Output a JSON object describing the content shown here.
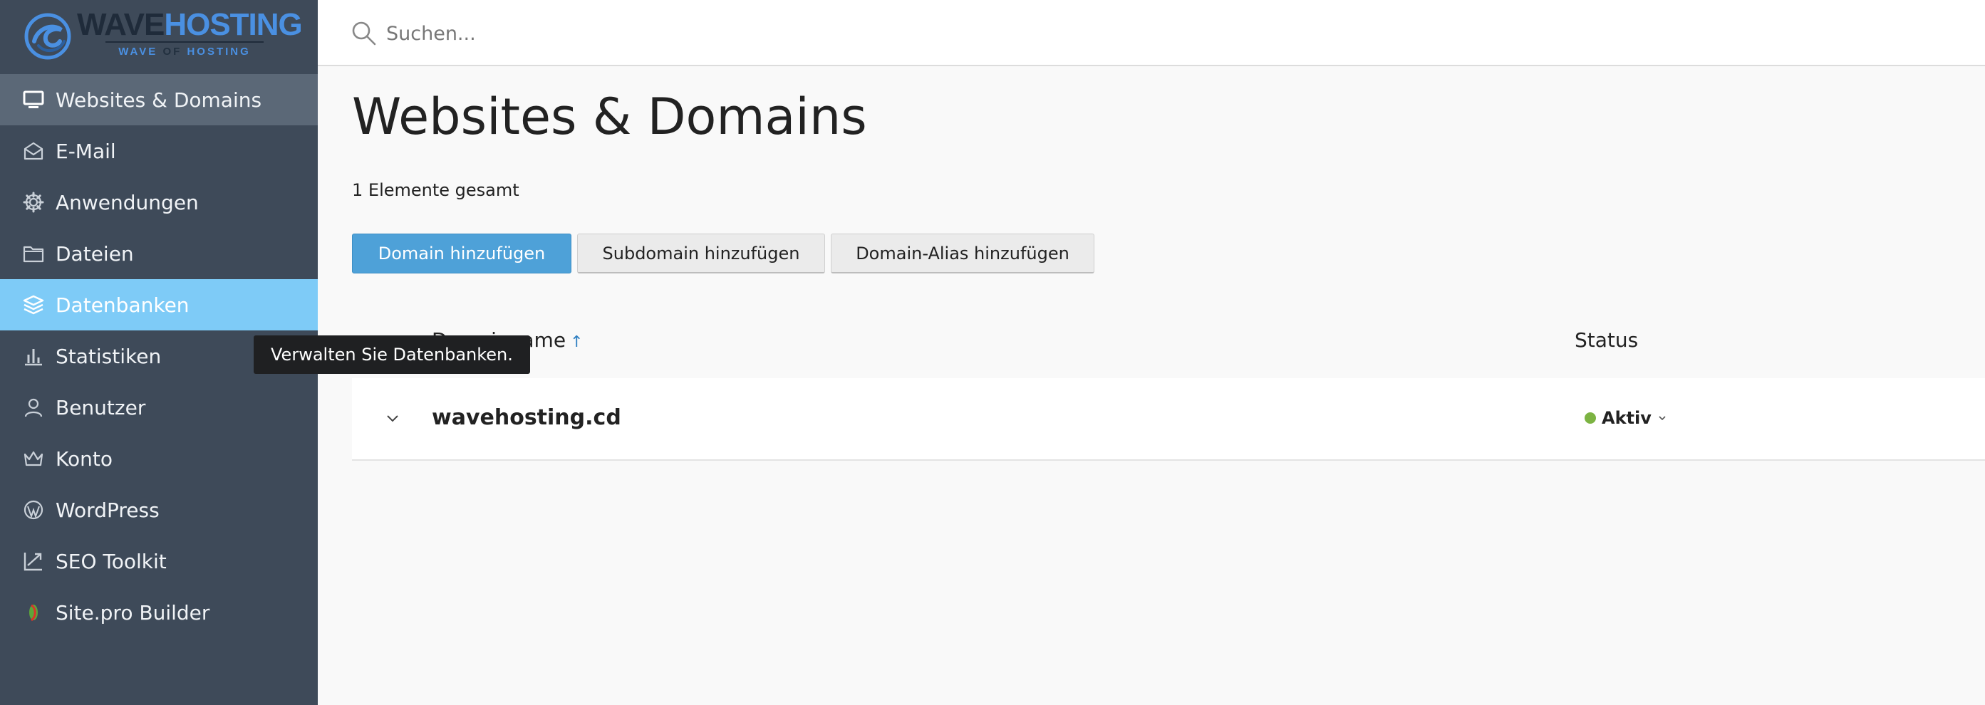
{
  "logo": {
    "word_dark": "WAVE",
    "word_blue": "HOSTING",
    "sub_left": "WAVE",
    "sub_mid": "OF",
    "sub_right": "HOSTING"
  },
  "sidebar": {
    "items": [
      {
        "label": "Websites & Domains",
        "icon": "monitor-icon",
        "state": "current"
      },
      {
        "label": "E-Mail",
        "icon": "envelope-icon"
      },
      {
        "label": "Anwendungen",
        "icon": "gear-icon"
      },
      {
        "label": "Dateien",
        "icon": "folder-icon"
      },
      {
        "label": "Datenbanken",
        "icon": "layers-icon",
        "state": "hover"
      },
      {
        "label": "Statistiken",
        "icon": "bar-chart-icon"
      },
      {
        "label": "Benutzer",
        "icon": "user-icon"
      },
      {
        "label": "Konto",
        "icon": "crown-icon"
      },
      {
        "label": "WordPress",
        "icon": "wordpress-icon"
      },
      {
        "label": "SEO Toolkit",
        "icon": "trend-chart-icon"
      },
      {
        "label": "Site.pro Builder",
        "icon": "sitepro-icon"
      }
    ]
  },
  "tooltip": {
    "text": "Verwalten Sie Datenbanken."
  },
  "search": {
    "placeholder": "Suchen..."
  },
  "main": {
    "title": "Websites & Domains",
    "count_text": "1 Elemente gesamt",
    "buttons": {
      "add_domain": "Domain hinzufügen",
      "add_subdomain": "Subdomain hinzufügen",
      "add_alias": "Domain-Alias hinzufügen"
    },
    "table": {
      "columns": {
        "name": "Domainname",
        "sort_indicator": "↑",
        "status": "Status"
      },
      "rows": [
        {
          "domain": "wavehosting.cd",
          "status": "Aktiv"
        }
      ]
    }
  },
  "colors": {
    "sidebar_bg": "#3e4a59",
    "sidebar_current": "#5b6877",
    "sidebar_hover": "#7ecbf7",
    "primary_button": "#4ea1d8",
    "status_active": "#7cb342",
    "logo_blue": "#4a90e2"
  }
}
